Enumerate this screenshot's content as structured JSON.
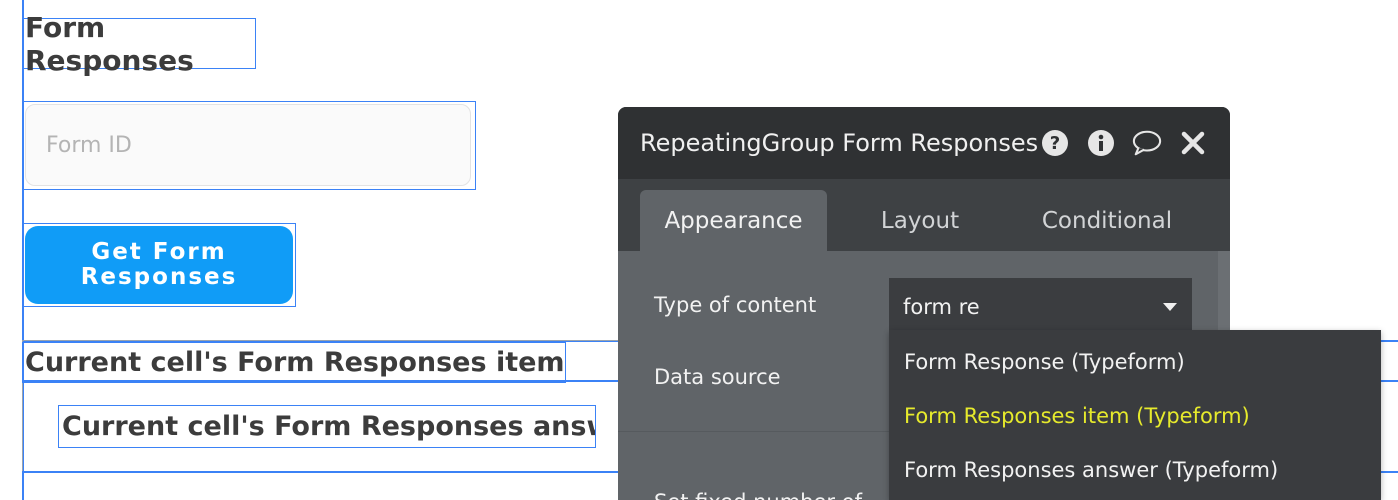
{
  "canvas": {
    "page_title": "Form Responses",
    "form_id_placeholder": "Form ID",
    "button_label": "Get Form Responses",
    "cell_text_1": "Current cell's Form Responses item (...",
    "cell_text_2": "Current cell's Form Responses answ..."
  },
  "editor": {
    "title": "RepeatingGroup Form Responses",
    "icons": [
      "help-icon",
      "info-icon",
      "comment-icon",
      "close-icon"
    ],
    "tabs": [
      "Appearance",
      "Layout",
      "Conditional"
    ],
    "active_tab": "Appearance",
    "type_label": "Type of content",
    "type_value": "form re",
    "data_source_label": "Data source",
    "partial_label": "Set fixed number of"
  },
  "dropdown": {
    "options": [
      "Form Response (Typeform)",
      "Form Responses item (Typeform)",
      "Form Responses answer (Typeform)"
    ],
    "highlighted_index": 1,
    "highlight_color": "#e6ea2c"
  },
  "colors": {
    "selection": "#3b82f6",
    "button": "#109cf7",
    "editor_header": "#2f3133",
    "editor_body": "#606468"
  }
}
